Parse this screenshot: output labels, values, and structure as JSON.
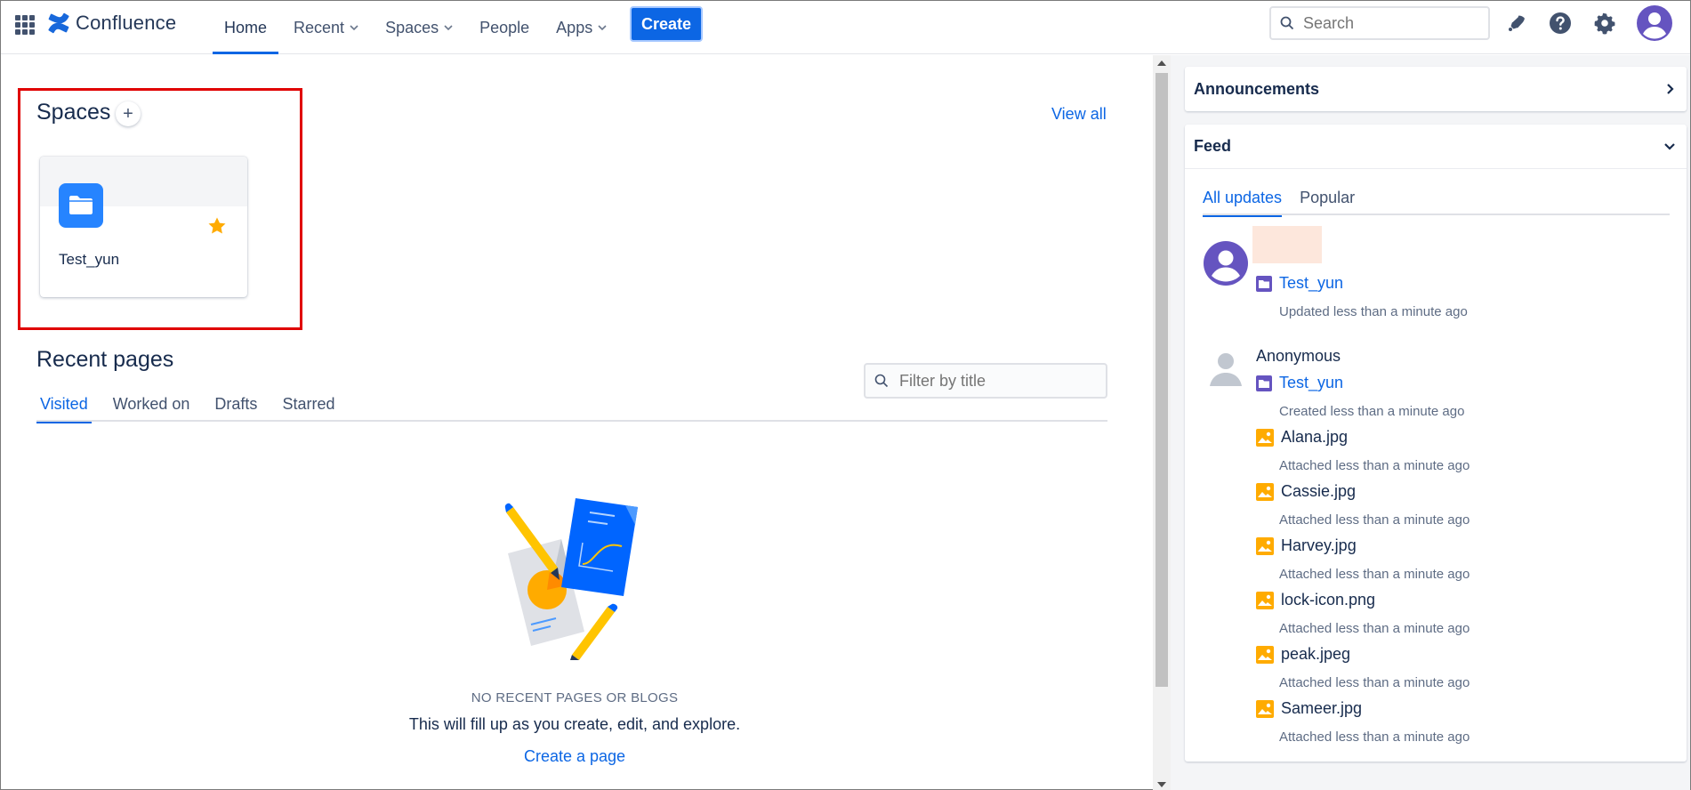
{
  "nav": {
    "brand": "Confluence",
    "items": [
      {
        "label": "Home",
        "active": true,
        "dropdown": false
      },
      {
        "label": "Recent",
        "active": false,
        "dropdown": true
      },
      {
        "label": "Spaces",
        "active": false,
        "dropdown": true
      },
      {
        "label": "People",
        "active": false,
        "dropdown": false
      },
      {
        "label": "Apps",
        "active": false,
        "dropdown": true
      }
    ],
    "create_label": "Create",
    "search_placeholder": "Search",
    "icons": [
      "notifications-icon",
      "help-icon",
      "settings-icon",
      "profile-avatar"
    ],
    "accent": "#0c66e4"
  },
  "spaces": {
    "title": "Spaces",
    "add_label": "+",
    "view_all": "View all",
    "cards": [
      {
        "name": "Test_yun",
        "starred": true,
        "icon": "folder-icon",
        "color": "#2684ff"
      }
    ]
  },
  "recent": {
    "title": "Recent pages",
    "tabs": [
      "Visited",
      "Worked on",
      "Drafts",
      "Starred"
    ],
    "active_tab": "Visited",
    "filter_placeholder": "Filter by title",
    "empty_title": "NO RECENT PAGES OR BLOGS",
    "empty_desc": "This will fill up as you create, edit, and explore.",
    "create_link": "Create a page"
  },
  "right": {
    "announcements": "Announcements",
    "feed": "Feed",
    "feed_tabs": [
      "All updates",
      "Popular"
    ],
    "active_feed_tab": "All updates",
    "entries": [
      {
        "user": "",
        "space": "Test_yun",
        "space_meta": "Updated less than a minute ago",
        "attachments": []
      },
      {
        "user": "Anonymous",
        "space": "Test_yun",
        "space_meta": "Created less than a minute ago",
        "attachments": [
          {
            "name": "Alana.jpg",
            "meta": "Attached less than a minute ago"
          },
          {
            "name": "Cassie.jpg",
            "meta": "Attached less than a minute ago"
          },
          {
            "name": "Harvey.jpg",
            "meta": "Attached less than a minute ago"
          },
          {
            "name": "lock-icon.png",
            "meta": "Attached less than a minute ago"
          },
          {
            "name": "peak.jpeg",
            "meta": "Attached less than a minute ago"
          },
          {
            "name": "Sameer.jpg",
            "meta": "Attached less than a minute ago"
          }
        ]
      }
    ]
  }
}
